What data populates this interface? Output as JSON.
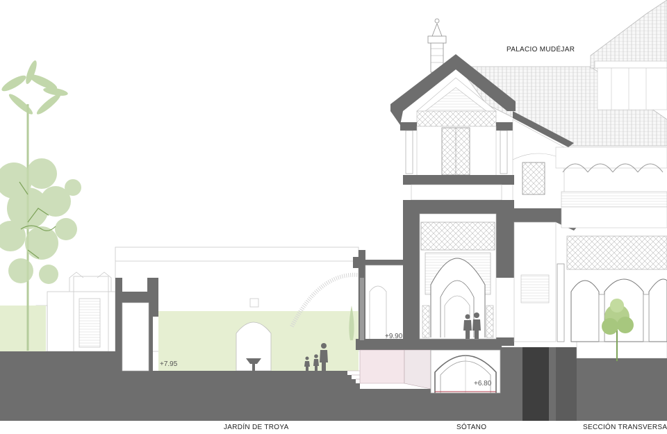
{
  "labels": {
    "palace": "PALACIO MUDÉJAR",
    "garden": "JARDÍN DE TROYA",
    "basement": "SÓTANO",
    "section": "SECCIÓN TRANSVERSAL"
  },
  "levels": {
    "garden_level": "+7.95",
    "ground_level": "+9.90",
    "basement_level": "+6.80"
  },
  "colors": {
    "cut": "#6e6e6e",
    "line": "#a8a8a8",
    "garden": "#e6efd2",
    "foliage": "#a9c98a",
    "basement": "#f4e6ea"
  }
}
